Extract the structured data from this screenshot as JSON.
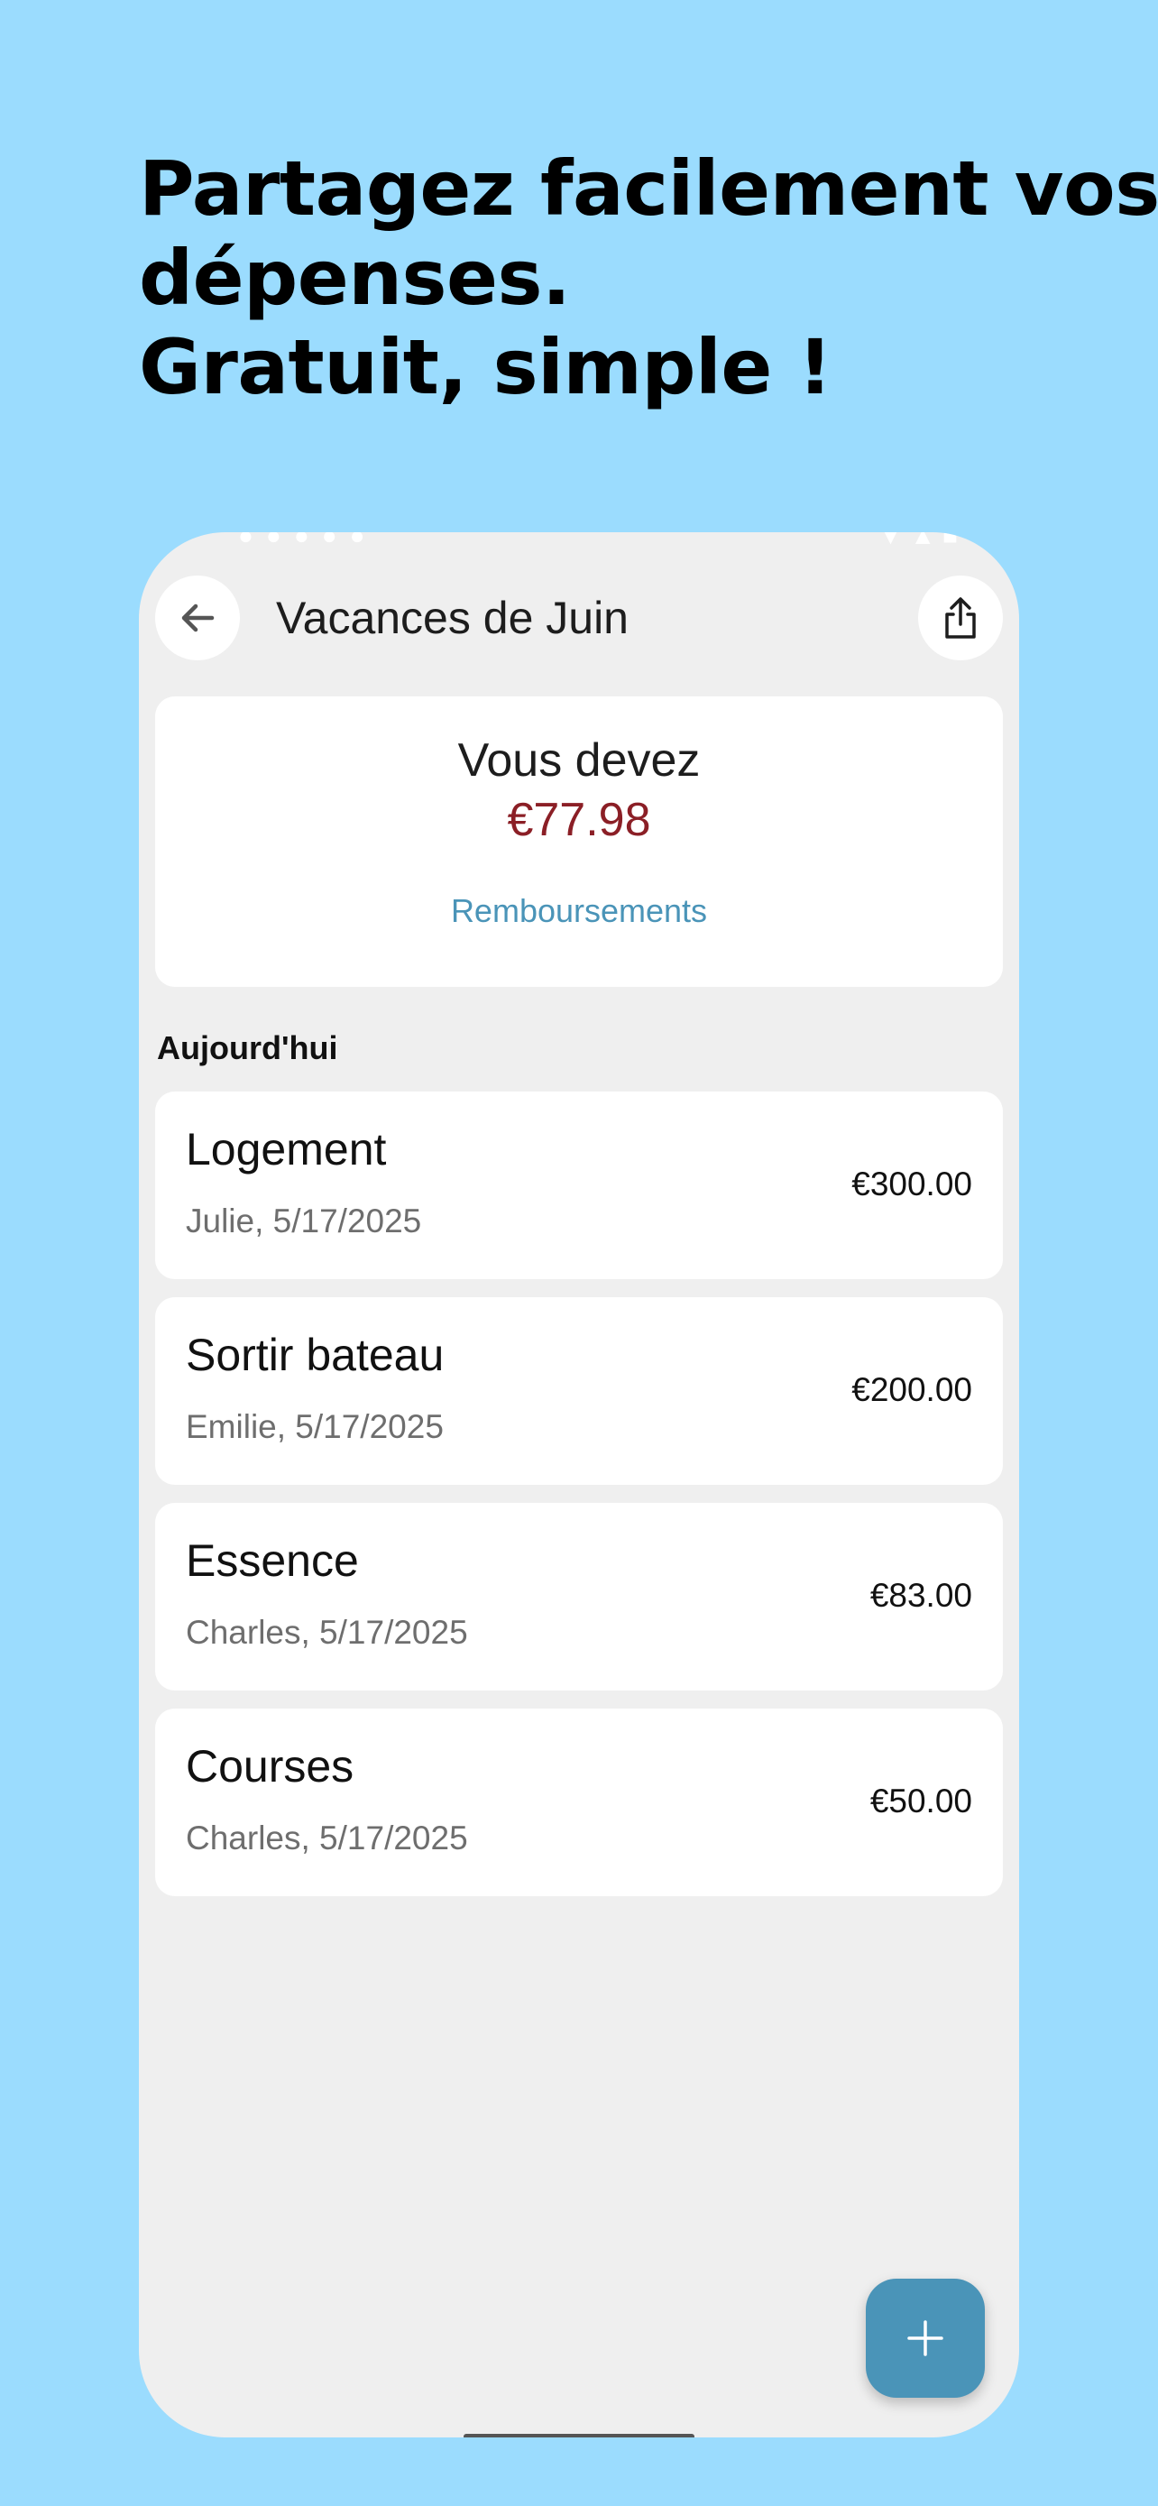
{
  "headline": {
    "line1": "Partagez facilement vos",
    "line2": "dépenses.",
    "line3": "Gratuit, simple !"
  },
  "header": {
    "title": "Vacances de Juin",
    "back_icon": "arrow-left-icon",
    "share_icon": "share-icon"
  },
  "summary": {
    "label": "Vous devez",
    "amount": "€77.98",
    "amount_color": "#8b1f26",
    "link": "Remboursements",
    "link_color": "#4a94b8"
  },
  "section": {
    "label": "Aujourd'hui"
  },
  "expenses": [
    {
      "title": "Logement",
      "meta": "Julie, 5/17/2025",
      "amount": "€300.00"
    },
    {
      "title": "Sortir bateau",
      "meta": "Emilie, 5/17/2025",
      "amount": "€200.00"
    },
    {
      "title": "Essence",
      "meta": "Charles, 5/17/2025",
      "amount": "€83.00"
    },
    {
      "title": "Courses",
      "meta": "Charles, 5/17/2025",
      "amount": "€50.00"
    }
  ],
  "fab": {
    "icon": "plus-icon",
    "color": "#4a94b8"
  },
  "colors": {
    "background": "#9bdcfe",
    "screen": "#efefef",
    "card": "#ffffff"
  }
}
